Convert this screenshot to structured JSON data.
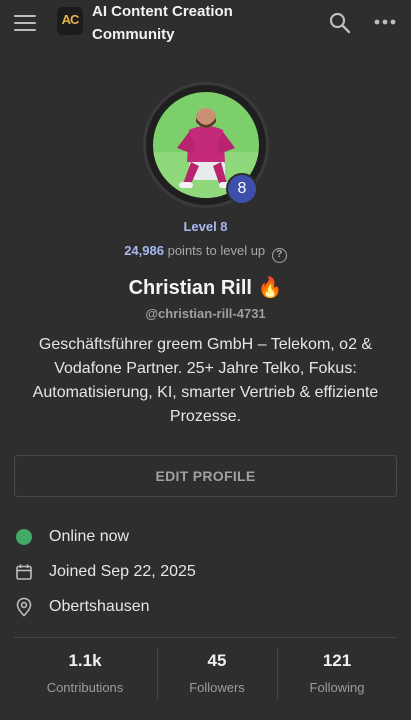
{
  "header": {
    "app_title": "AI Content Creation Community",
    "logo_text": "AC"
  },
  "profile": {
    "level_badge": "8",
    "level_label": "Level 8",
    "points_value": "24,986",
    "points_suffix": "points to level up",
    "name": "Christian Rill 🔥",
    "handle": "@christian-rill-4731",
    "bio": "Geschäftsführer greem GmbH – Telekom, o2 & Vodafone Partner. 25+ Jahre Telko, Fokus: Automatisierung, KI, smarter Vertrieb & effiziente Prozesse.",
    "edit_button": "EDIT PROFILE"
  },
  "info": {
    "status": "Online now",
    "joined": "Joined Sep 22, 2025",
    "location": "Obertshausen"
  },
  "stats": [
    {
      "value": "1.1k",
      "label": "Contributions"
    },
    {
      "value": "45",
      "label": "Followers"
    },
    {
      "value": "121",
      "label": "Following"
    }
  ],
  "colors": {
    "background": "#2e2e2e",
    "accent_level": "#a9b8ef",
    "level_badge": "#3d4fa8",
    "online": "#43a966",
    "avatar_bg": "#7ccf6a"
  }
}
